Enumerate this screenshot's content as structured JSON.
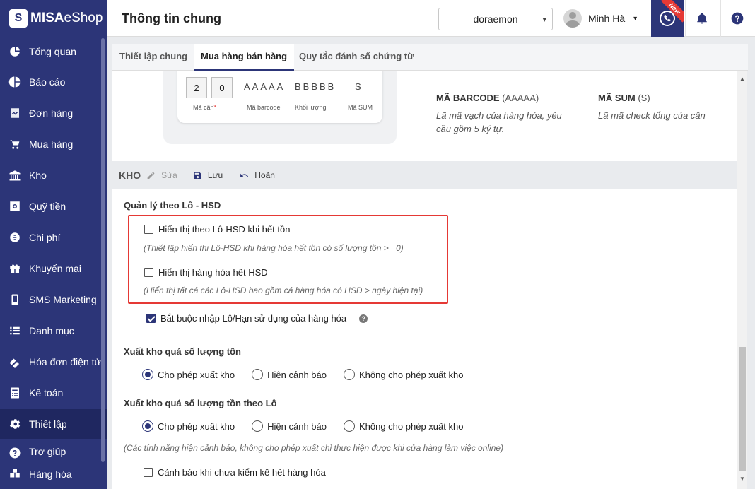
{
  "app": {
    "logo_prefix": "MISA",
    "logo_suffix": "eShop"
  },
  "sidebar": {
    "items": [
      {
        "label": "Tổng quan",
        "icon": "dashboard-icon"
      },
      {
        "label": "Báo cáo",
        "icon": "pie-chart-icon"
      },
      {
        "label": "Đơn hàng",
        "icon": "order-icon"
      },
      {
        "label": "Mua hàng",
        "icon": "cart-icon"
      },
      {
        "label": "Kho",
        "icon": "warehouse-icon"
      },
      {
        "label": "Quỹ tiền",
        "icon": "safe-icon"
      },
      {
        "label": "Chi phí",
        "icon": "money-icon"
      },
      {
        "label": "Khuyến mại",
        "icon": "gift-icon"
      },
      {
        "label": "SMS Marketing",
        "icon": "phone-icon"
      },
      {
        "label": "Danh mục",
        "icon": "list-icon"
      },
      {
        "label": "Hóa đơn điện tử",
        "icon": "einvoice-icon"
      },
      {
        "label": "Kế toán",
        "icon": "calculator-icon"
      },
      {
        "label": "Thiết lập",
        "icon": "gear-icon",
        "active": true
      },
      {
        "label": "Trợ giúp",
        "icon": "help-icon"
      },
      {
        "label": "Hàng hóa",
        "icon": "goods-icon"
      }
    ]
  },
  "header": {
    "title": "Thông tin chung",
    "store": "doraemon",
    "user_name": "Minh Hà",
    "new_badge": "New"
  },
  "tabs": [
    {
      "label": "Thiết lập chung"
    },
    {
      "label": "Mua hàng bán hàng",
      "active": true
    },
    {
      "label": "Quy tắc đánh số chứng từ"
    }
  ],
  "barcode_preview": {
    "digits": [
      "2",
      "0"
    ],
    "barcode": "AAAAA",
    "weight": "BBBBB",
    "sum": "S",
    "labels": {
      "scale": "Mã cân",
      "required_mark": "*",
      "barcode": "Mã barcode",
      "weight": "Khối lượng",
      "sum": "Mã SUM"
    }
  },
  "barcode_info": {
    "barcode_title": "MÃ BARCODE",
    "barcode_suffix": "(AAAAA)",
    "barcode_desc_1": "Lã mã vạch của hàng hóa, yêu",
    "barcode_desc_2": "cầu gồm 5 ký tự.",
    "sum_title": "MÃ SUM",
    "sum_suffix": "(S)",
    "sum_desc": "Lã mã check tổng của cân"
  },
  "section": {
    "title": "KHO",
    "edit_label": "Sửa",
    "save_label": "Lưu",
    "undo_label": "Hoãn"
  },
  "lot": {
    "title": "Quản lý theo Lô - HSD",
    "option1_label": "Hiển thị theo Lô-HSD khi hết tồn",
    "option1_hint": "(Thiết lập hiển thị Lô-HSD khi hàng hóa hết tồn có số lượng tồn >= 0)",
    "option1_checked": false,
    "option2_label": "Hiển thị hàng hóa hết HSD",
    "option2_hint": "(Hiển thị tất cả các Lô-HSD bao gồm cả hàng hóa có HSD > ngày hiện tại)",
    "option2_checked": false,
    "required_label": "Bắt buộc nhập Lô/Hạn sử dụng của hàng hóa",
    "required_checked": true,
    "help_glyph": "?"
  },
  "over_stock": {
    "title": "Xuất kho quá số lượng tồn",
    "options": [
      "Cho phép xuất kho",
      "Hiện cảnh báo",
      "Không cho phép xuất kho"
    ],
    "selected": 0
  },
  "over_stock_lot": {
    "title": "Xuất kho quá số lượng tồn theo Lô",
    "options": [
      "Cho phép xuất kho",
      "Hiện cảnh báo",
      "Không cho phép xuất kho"
    ],
    "selected": 0,
    "note": "(Các tính năng hiện cảnh báo, không cho phép xuất chỉ thực hiện được khi cửa hàng làm việc online)"
  },
  "inventory_warning": {
    "label": "Cảnh báo khi chưa kiểm kê hết hàng hóa",
    "checked": false
  },
  "colors": {
    "brand": "#2c3578",
    "highlight": "#e53935"
  }
}
